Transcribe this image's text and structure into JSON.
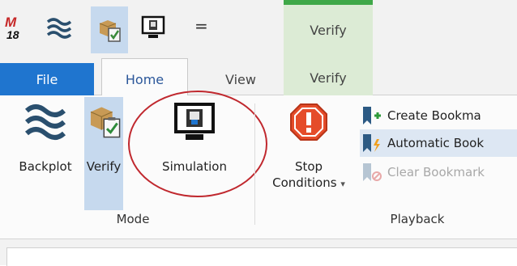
{
  "qat": {
    "app_logo_text": "M",
    "app_logo_version": "18",
    "customize_glyph": "="
  },
  "contextual_group": {
    "header_label": "Verify"
  },
  "tabs": {
    "file": "File",
    "home": "Home",
    "view": "View",
    "verify": "Verify"
  },
  "ribbon": {
    "mode_group": {
      "label": "Mode",
      "buttons": [
        {
          "label": "Backplot",
          "icon": "backplot-waves-icon"
        },
        {
          "label": "Verify",
          "icon": "verify-box-clipboard-icon"
        },
        {
          "label": "Simulation",
          "icon": "simulation-monitor-icon"
        }
      ]
    },
    "playback_group": {
      "label": "Playback",
      "stop_conditions": {
        "line1": "Stop",
        "line2": "Conditions",
        "dropdown": "▾"
      },
      "small_buttons": [
        {
          "label": "Create Bookma",
          "icon": "create-bookmark-icon",
          "state": "normal"
        },
        {
          "label": "Automatic Book",
          "icon": "automatic-bookmark-icon",
          "state": "highlighted"
        },
        {
          "label": "Clear Bookmark",
          "icon": "clear-bookmark-icon",
          "state": "disabled"
        }
      ]
    }
  },
  "colors": {
    "file_tab": "#1f75cf",
    "contextual_green": "#3fa848",
    "active_blue": "#c6d9ee",
    "annotation_red": "#c0282e"
  }
}
